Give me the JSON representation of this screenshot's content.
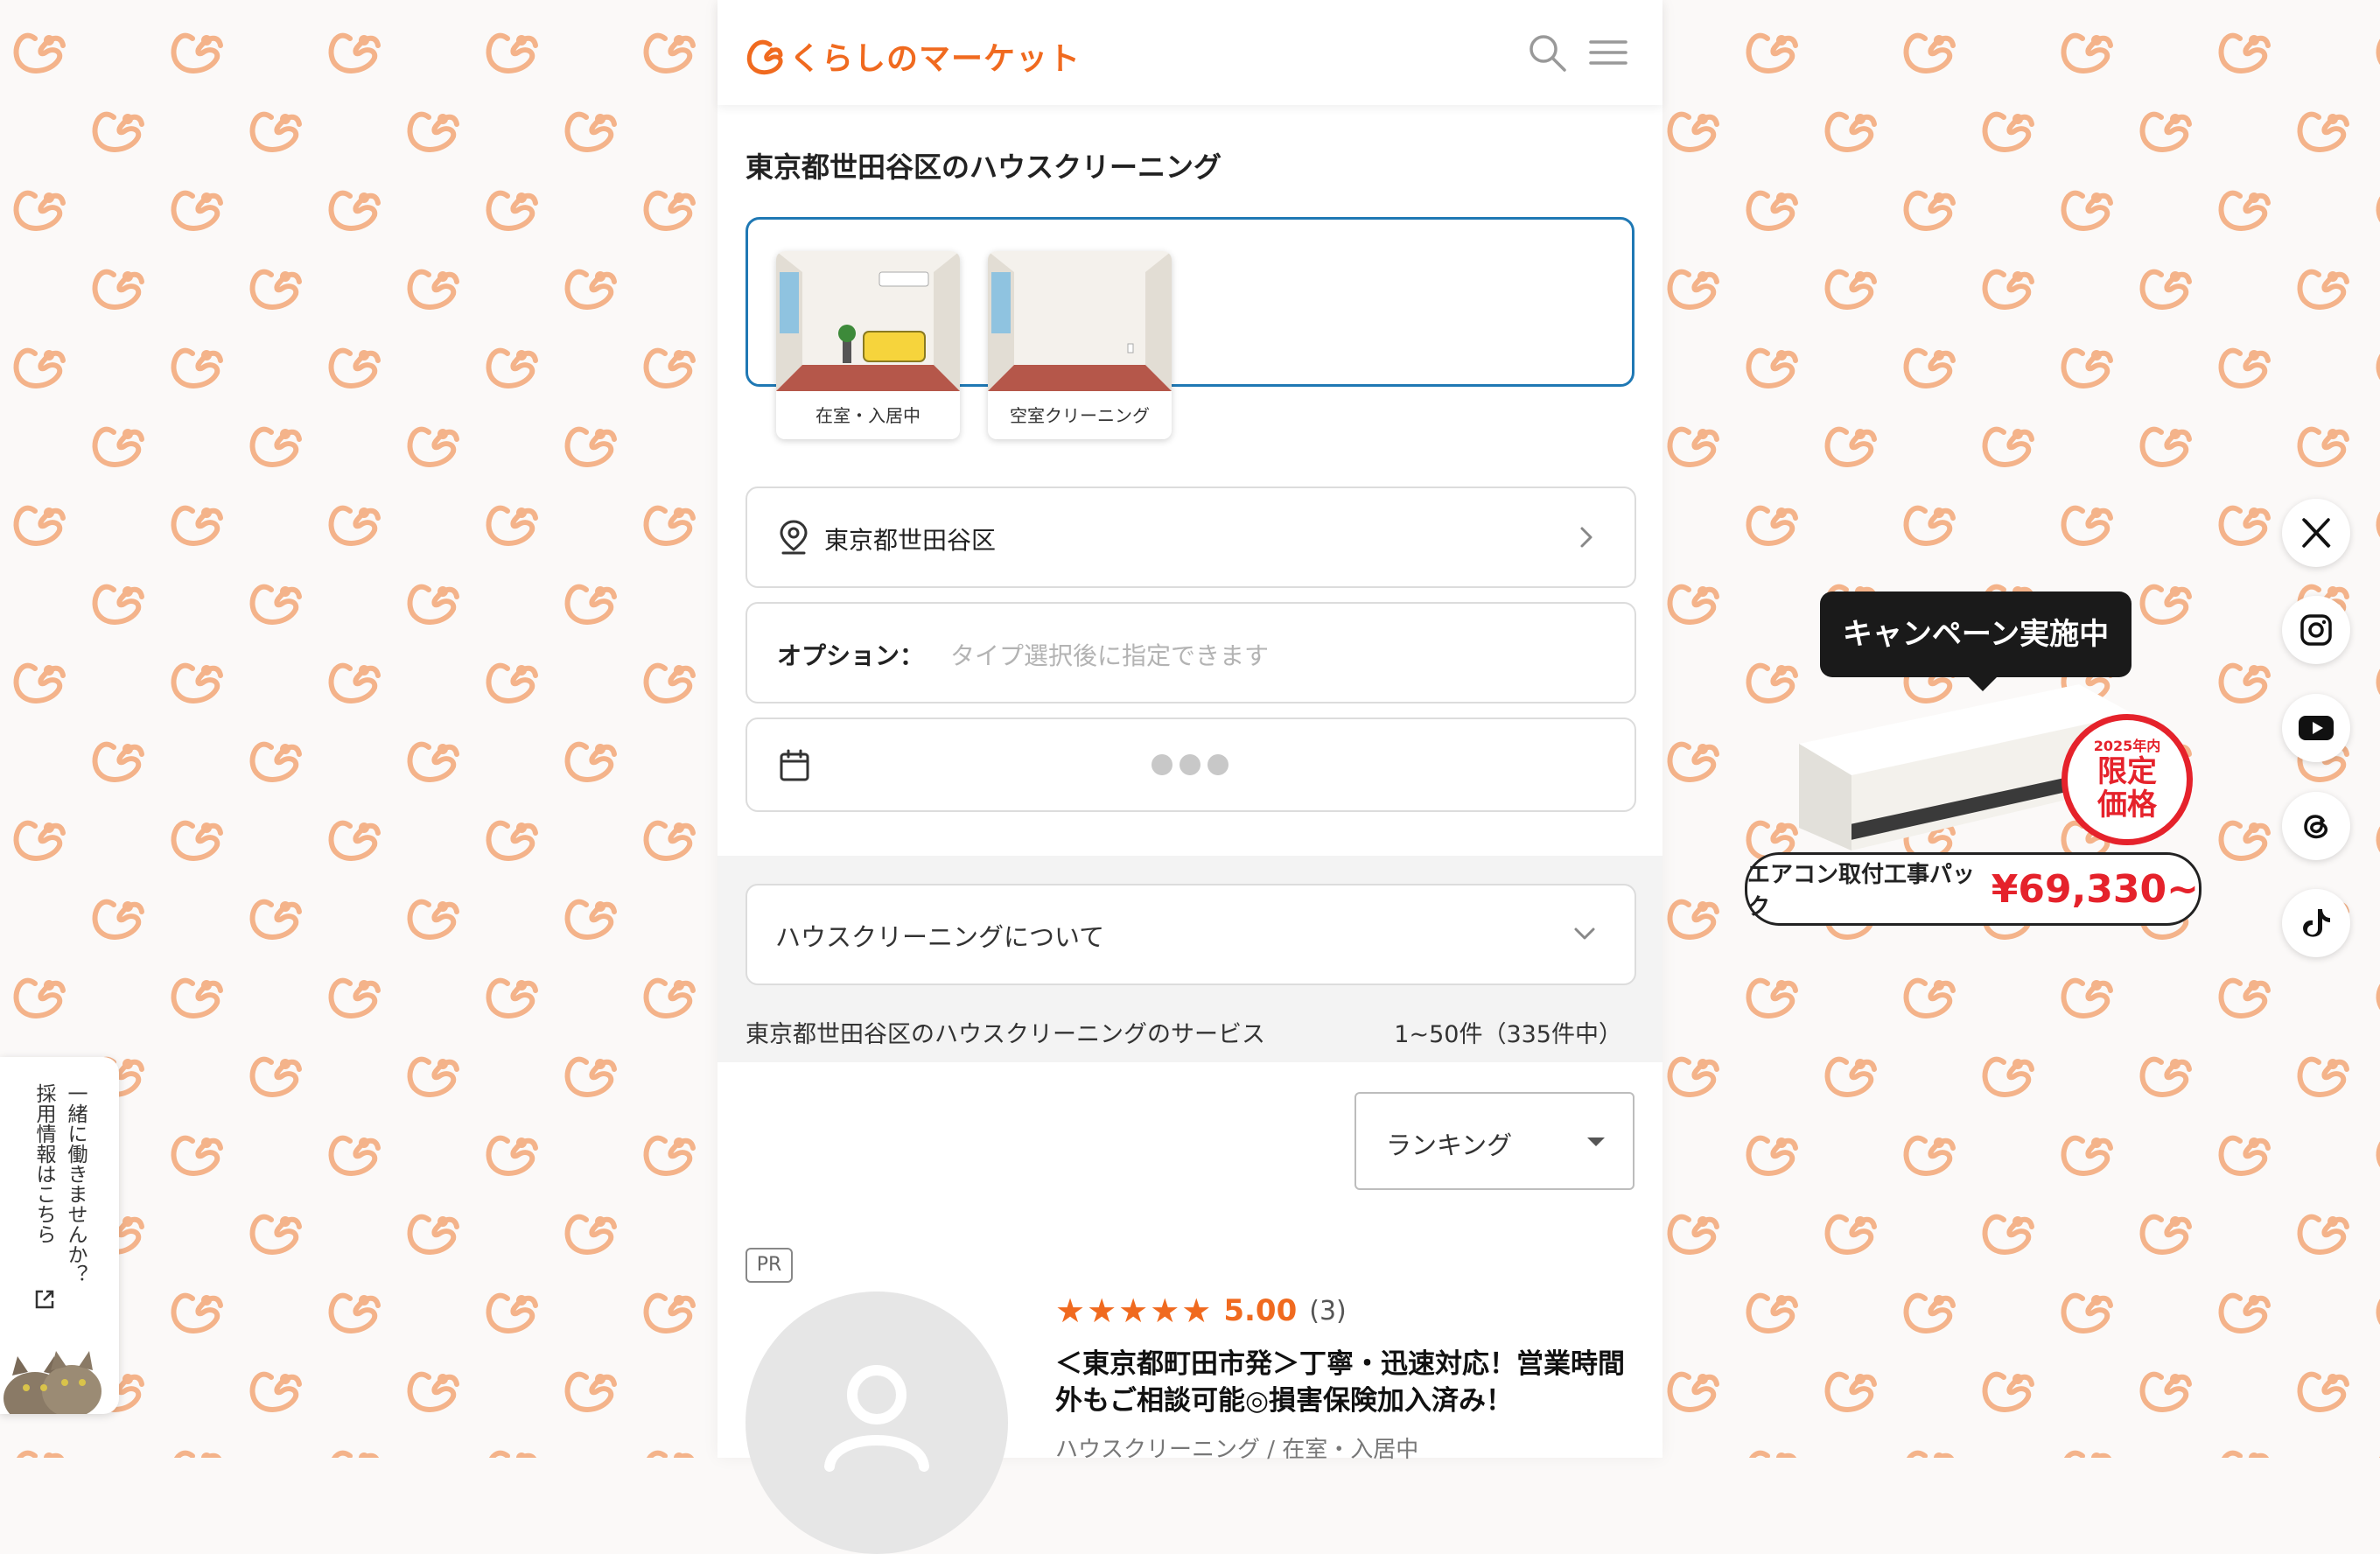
{
  "header": {
    "logo_text": "くらしのマーケット"
  },
  "page": {
    "title": "東京都世田谷区のハウスクリーニング"
  },
  "types": [
    {
      "label": "在室・入居中"
    },
    {
      "label": "空室クリーニング"
    }
  ],
  "location": {
    "value": "東京都世田谷区"
  },
  "options": {
    "label": "オプション：",
    "placeholder": "タイプ選択後に指定できます"
  },
  "about": {
    "label": "ハウスクリーニングについて"
  },
  "listing_summary": {
    "title": "東京都世田谷区のハウスクリーニングのサービス",
    "count": "1~50件（335件中）"
  },
  "sort": {
    "selected": "ランキング"
  },
  "listing": {
    "badge": "PR",
    "stars": "★★★★★",
    "rating": "5.00",
    "review_count": "(3)",
    "title": "＜東京都町田市発＞丁寧・迅速対応！営業時間外もご相談可能◎損害保険加入済み！",
    "category": "ハウスクリーニング / 在室・入居中"
  },
  "recruit": {
    "line1": "一緒に働きませんか？",
    "line2": "採用情報はこちら"
  },
  "campaign": {
    "tag": "キャンペーン実施中",
    "seal_year": "2025年内",
    "seal_line1": "限定",
    "seal_line2": "価格",
    "pack_label": "エアコン取付工事パック",
    "pack_price": "¥69,330~"
  },
  "social": [
    "x-icon",
    "instagram-icon",
    "youtube-icon",
    "threads-icon",
    "tiktok-icon"
  ],
  "colors": {
    "brand": "#f06a1f",
    "accent_blue": "#1f78b4",
    "campaign_red": "#e5222b"
  }
}
